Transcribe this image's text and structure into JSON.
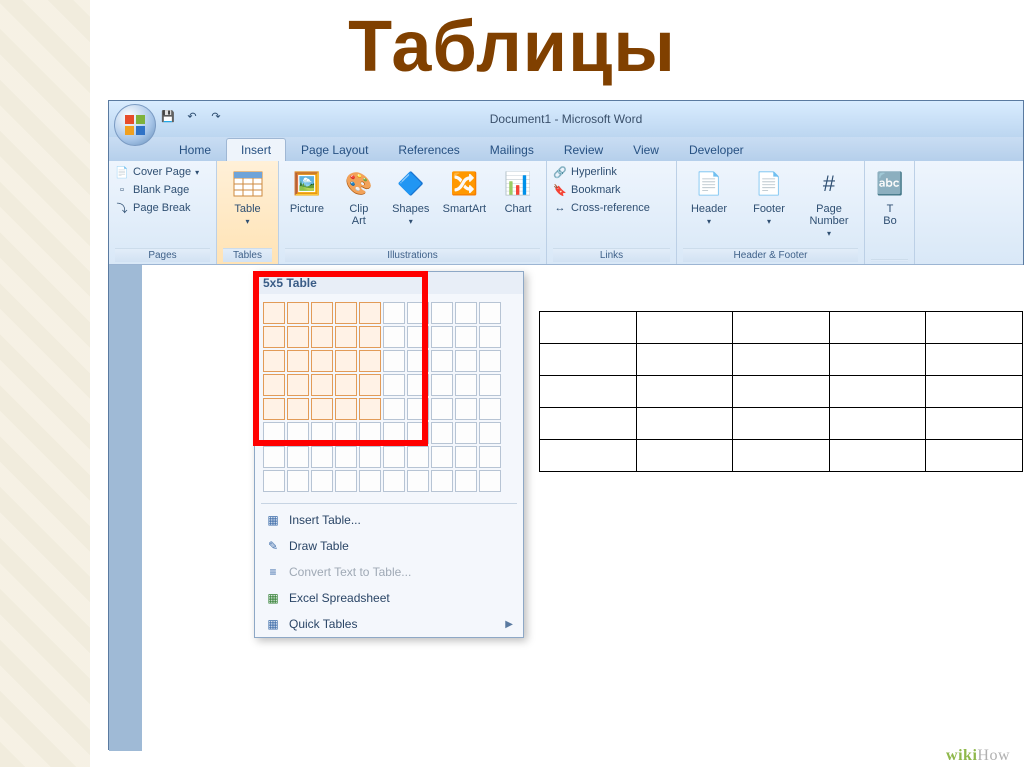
{
  "slide": {
    "title": "Таблицы",
    "watermark_wiki": "wiki",
    "watermark_how": "How"
  },
  "window": {
    "title": "Document1 - Microsoft Word"
  },
  "qat": {
    "save": "💾",
    "undo": "↶",
    "redo": "↷"
  },
  "tabs": {
    "home": "Home",
    "insert": "Insert",
    "page_layout": "Page Layout",
    "references": "References",
    "mailings": "Mailings",
    "review": "Review",
    "view": "View",
    "developer": "Developer"
  },
  "groups": {
    "pages": {
      "label": "Pages",
      "cover_page": "Cover Page",
      "blank_page": "Blank Page",
      "page_break": "Page Break"
    },
    "tables": {
      "label": "Tables",
      "table": "Table"
    },
    "illustrations": {
      "label": "Illustrations",
      "picture": "Picture",
      "clip_art": "Clip\nArt",
      "shapes": "Shapes",
      "smartart": "SmartArt",
      "chart": "Chart"
    },
    "links": {
      "label": "Links",
      "hyperlink": "Hyperlink",
      "bookmark": "Bookmark",
      "cross_reference": "Cross-reference"
    },
    "header_footer": {
      "label": "Header & Footer",
      "header": "Header",
      "footer": "Footer",
      "page_number": "Page\nNumber"
    },
    "text": {
      "text_box": "T\nBo"
    }
  },
  "table_panel": {
    "header": "5x5 Table",
    "insert_table": "Insert Table...",
    "draw_table": "Draw Table",
    "convert": "Convert Text to Table...",
    "excel": "Excel Spreadsheet",
    "quick": "Quick Tables"
  },
  "grid": {
    "rows": 8,
    "cols": 10,
    "sel_rows": 5,
    "sel_cols": 5
  },
  "inserted_table": {
    "rows": 5,
    "cols": 5
  }
}
